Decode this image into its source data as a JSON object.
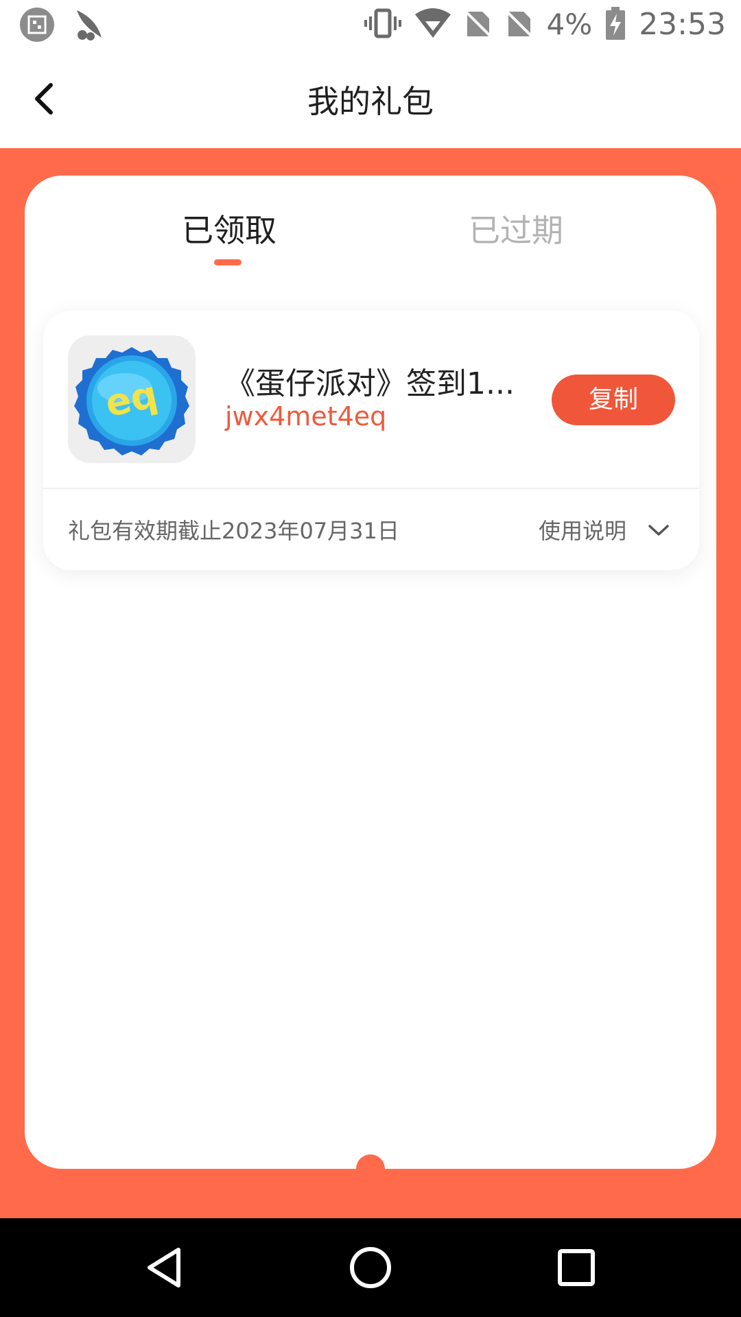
{
  "status_bar": {
    "battery_percent": "4%",
    "time": "23:53",
    "icons": [
      "qr-app-icon",
      "bean-app-icon",
      "vibrate-icon",
      "wifi-icon",
      "no-sim-icon",
      "no-sim-icon",
      "battery-charging-icon"
    ]
  },
  "header": {
    "title": "我的礼包",
    "back_icon": "back-arrow-icon"
  },
  "tabs": [
    {
      "label": "已领取",
      "active": true
    },
    {
      "label": "已过期",
      "active": false
    }
  ],
  "gift": {
    "title": "《蛋仔派对》签到1...",
    "code": "jwx4met4eq",
    "copy_label": "复制",
    "expiry_text": "礼包有效期截止2023年07月31日",
    "usage_label": "使用说明",
    "icon": "game-bottlecap-icon"
  },
  "colors": {
    "accent": "#ff6b4a",
    "button": "#f0573a",
    "code_text": "#ef5a3c"
  },
  "nav_bar": {
    "buttons": [
      "back-triangle-icon",
      "home-circle-icon",
      "recents-square-icon"
    ]
  }
}
